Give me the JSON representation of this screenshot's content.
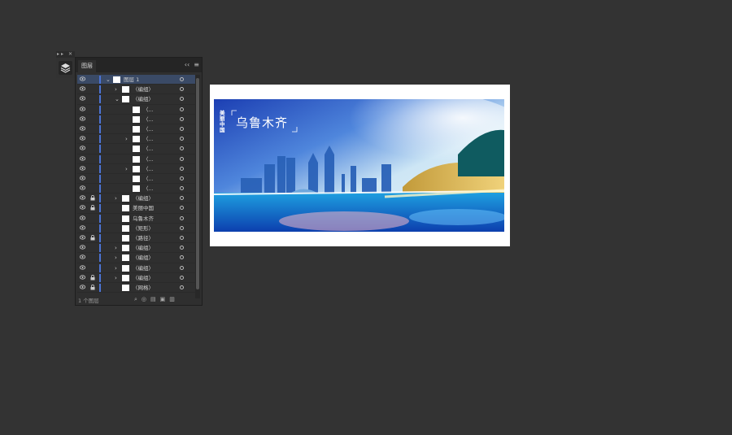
{
  "panel": {
    "tab_label": "图层",
    "collapse_icon": "double-chevron-left",
    "menu_icon": "hamburger-menu",
    "footer_count": "1 个图层",
    "footer_icons": [
      "search-icon",
      "target-icon",
      "sublayer-icon",
      "new-layer-icon",
      "trash-icon"
    ]
  },
  "layers": [
    {
      "label": "图层 1",
      "expand": "open",
      "level": 0,
      "lock": false,
      "selected": true
    },
    {
      "label": "〈编组〉",
      "expand": "closed",
      "level": 1,
      "lock": false
    },
    {
      "label": "〈编组〉",
      "expand": "open",
      "level": 1,
      "lock": false
    },
    {
      "label": "〈...",
      "expand": "none",
      "level": 2,
      "lock": false
    },
    {
      "label": "〈...",
      "expand": "none",
      "level": 2,
      "lock": false
    },
    {
      "label": "〈...",
      "expand": "none",
      "level": 2,
      "lock": false
    },
    {
      "label": "〈...",
      "expand": "closed",
      "level": 2,
      "lock": false
    },
    {
      "label": "〈...",
      "expand": "none",
      "level": 2,
      "lock": false
    },
    {
      "label": "〈...",
      "expand": "none",
      "level": 2,
      "lock": false
    },
    {
      "label": "〈...",
      "expand": "closed",
      "level": 2,
      "lock": false
    },
    {
      "label": "〈...",
      "expand": "none",
      "level": 2,
      "lock": false
    },
    {
      "label": "〈...",
      "expand": "none",
      "level": 2,
      "lock": false
    },
    {
      "label": "〈编组〉",
      "expand": "closed",
      "level": 1,
      "lock": true
    },
    {
      "label": "美丽中国",
      "expand": "none",
      "level": 1,
      "lock": true
    },
    {
      "label": "乌鲁木齐",
      "expand": "none",
      "level": 1,
      "lock": false
    },
    {
      "label": "〈矩形〉",
      "expand": "none",
      "level": 1,
      "lock": false
    },
    {
      "label": "〈路径〉",
      "expand": "none",
      "level": 1,
      "lock": true
    },
    {
      "label": "〈编组〉",
      "expand": "closed",
      "level": 1,
      "lock": false
    },
    {
      "label": "〈编组〉",
      "expand": "closed",
      "level": 1,
      "lock": false
    },
    {
      "label": "〈编组〉",
      "expand": "closed",
      "level": 1,
      "lock": false
    },
    {
      "label": "〈编组〉",
      "expand": "closed",
      "level": 1,
      "lock": true
    },
    {
      "label": "〈网格〉",
      "expand": "none",
      "level": 1,
      "lock": true
    }
  ],
  "artwork": {
    "side_text": "美丽中国",
    "title": "乌鲁木齐"
  },
  "colors": {
    "workspace": "#333333",
    "selection": "#3a4a66",
    "layer_bar": "#4b73d3"
  }
}
